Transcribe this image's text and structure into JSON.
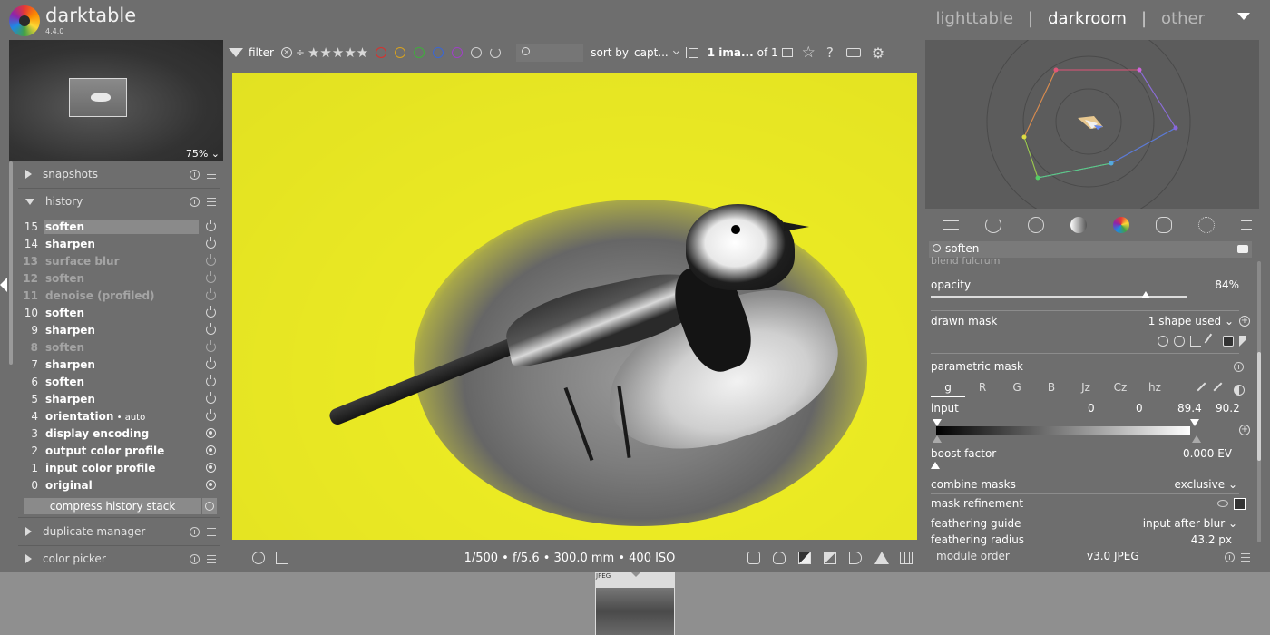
{
  "header": {
    "app_name": "darktable",
    "version": "4.4.0",
    "views": [
      {
        "label": "lighttable",
        "active": false
      },
      {
        "label": "darkroom",
        "active": true
      },
      {
        "label": "other",
        "active": false
      }
    ],
    "separator": "|"
  },
  "navigator": {
    "zoom": "75%"
  },
  "left_panel": {
    "snapshots_label": "snapshots",
    "history_label": "history",
    "history": [
      {
        "num": "15",
        "name": "soften",
        "state": "on",
        "selected": true
      },
      {
        "num": "14",
        "name": "sharpen",
        "state": "on"
      },
      {
        "num": "13",
        "name": "surface blur",
        "state": "off"
      },
      {
        "num": "12",
        "name": "soften",
        "state": "off"
      },
      {
        "num": "11",
        "name": "denoise (profiled)",
        "state": "off"
      },
      {
        "num": "10",
        "name": "soften",
        "state": "on"
      },
      {
        "num": "9",
        "name": "sharpen",
        "state": "on"
      },
      {
        "num": "8",
        "name": "soften",
        "state": "off"
      },
      {
        "num": "7",
        "name": "sharpen",
        "state": "on"
      },
      {
        "num": "6",
        "name": "soften",
        "state": "on"
      },
      {
        "num": "5",
        "name": "sharpen",
        "state": "on"
      },
      {
        "num": "4",
        "name": "orientation",
        "suffix": " • auto",
        "state": "on"
      },
      {
        "num": "3",
        "name": "display encoding",
        "state": "always"
      },
      {
        "num": "2",
        "name": "output color profile",
        "state": "always"
      },
      {
        "num": "1",
        "name": "input color profile",
        "state": "always"
      },
      {
        "num": "0",
        "name": "original",
        "state": "always"
      }
    ],
    "compress_label": "compress history stack",
    "duplicate_manager_label": "duplicate manager",
    "color_picker_label": "color picker"
  },
  "toolbar": {
    "filter_label": "filter",
    "stars": "★★★★★",
    "color_labels": [
      "#d9302c",
      "#d8a21f",
      "#3fae3c",
      "#3a66d6",
      "#a13fc7",
      "#cfcfcf"
    ],
    "sort_by_label": "sort by",
    "sort_by_value": "capt...",
    "count_label": "1 ima...",
    "count_of": "of 1"
  },
  "bottombar": {
    "exif": "1/500 • f/5.6 • 300.0 mm • 400 ISO"
  },
  "filmstrip": {
    "thumb_label": "JPEG"
  },
  "right_panel": {
    "search_value": "soften",
    "blend_fulcrum_label": "blend fulcrum",
    "opacity_label": "opacity",
    "opacity_value": "84%",
    "opacity_fraction": 0.84,
    "drawn_mask_label": "drawn mask",
    "drawn_mask_value": "1 shape used",
    "parametric_mask_label": "parametric mask",
    "channels": [
      "g",
      "R",
      "G",
      "B",
      "Jz",
      "Cz",
      "hz"
    ],
    "input_label": "input",
    "input_values": [
      "0",
      "0",
      "89.4",
      "90.2"
    ],
    "boost_factor_label": "boost factor",
    "boost_factor_value": "0.000 EV",
    "combine_masks_label": "combine masks",
    "combine_masks_value": "exclusive",
    "mask_refinement_label": "mask refinement",
    "feathering_guide_label": "feathering guide",
    "feathering_guide_value": "input after blur",
    "feathering_radius_label": "feathering radius",
    "feathering_radius_value": "43.2 px"
  },
  "module_order": {
    "label": "module order",
    "value": "v3.0 JPEG"
  }
}
